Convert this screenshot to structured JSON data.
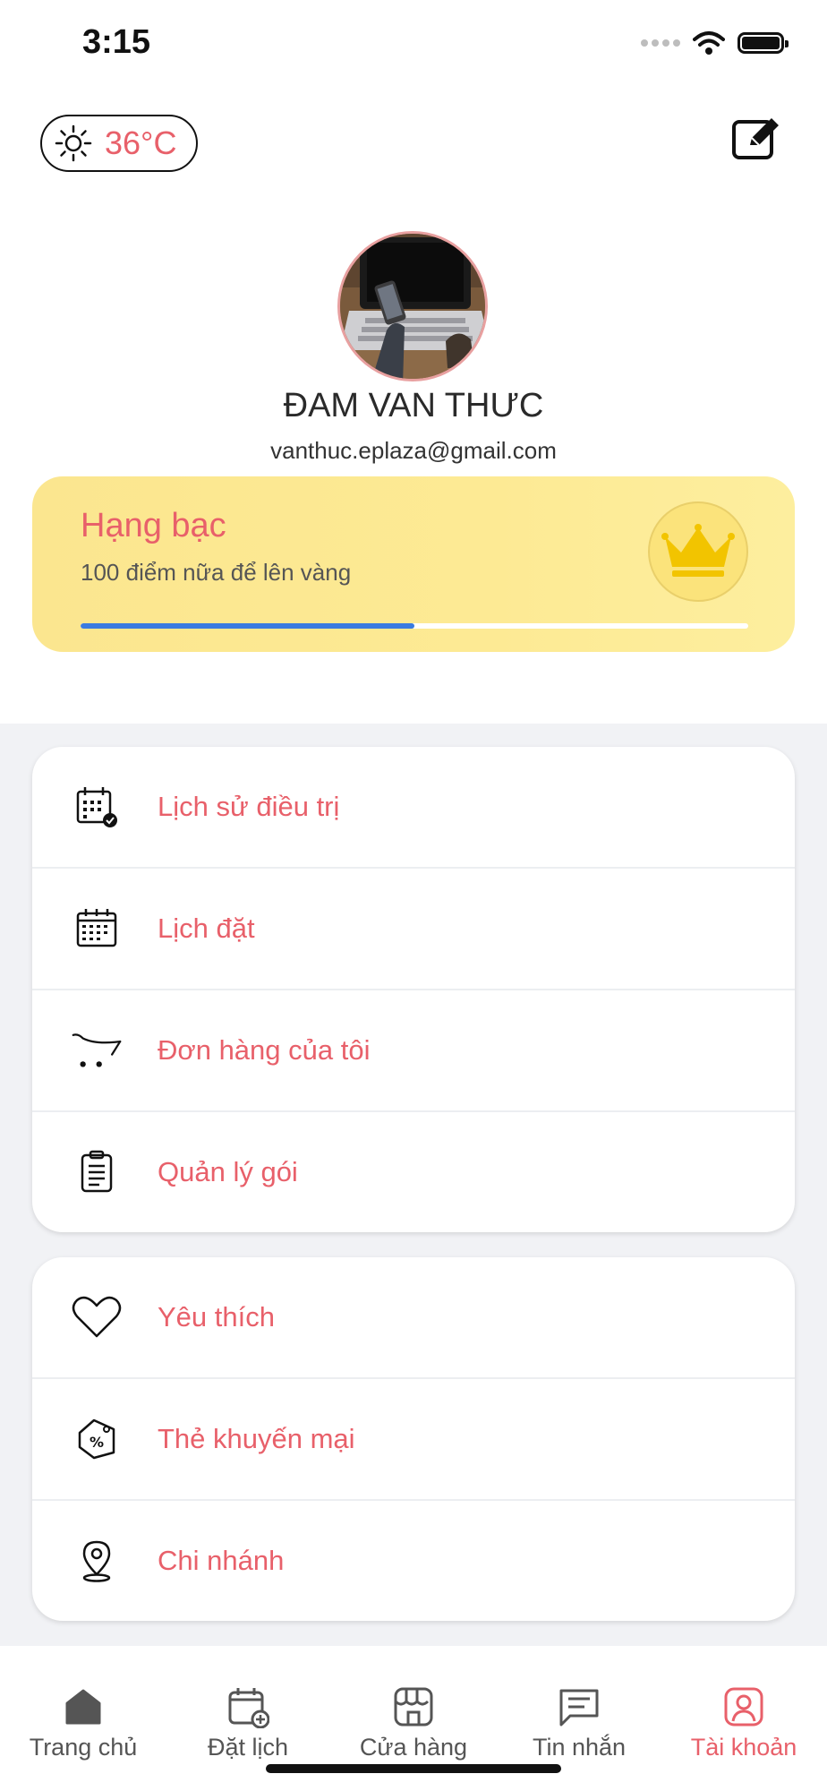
{
  "status_bar": {
    "time": "3:15"
  },
  "header": {
    "weather": {
      "icon": "sun-icon",
      "temperature": "36°C"
    },
    "edit_icon": "edit-icon"
  },
  "profile": {
    "name": "ĐAM VAN THƯC",
    "email": "vanthuc.eplaza@gmail.com"
  },
  "rank": {
    "title": "Hạng bạc",
    "subtitle": "100 điểm nữa để lên vàng",
    "icon": "crown-icon",
    "progress": 0.5
  },
  "menu_group_1": [
    {
      "label": "Lịch sử điều trị",
      "icon": "calendar-check-icon"
    },
    {
      "label": "Lịch đặt",
      "icon": "calendar-icon"
    },
    {
      "label": "Đơn hàng của tôi",
      "icon": "cart-icon"
    },
    {
      "label": "Quản lý gói",
      "icon": "clipboard-icon"
    }
  ],
  "menu_group_2": [
    {
      "label": "Yêu thích",
      "icon": "heart-icon"
    },
    {
      "label": "Thẻ khuyến mại",
      "icon": "discount-tag-icon"
    },
    {
      "label": "Chi nhánh",
      "icon": "location-pin-icon"
    }
  ],
  "bottom_nav": [
    {
      "label": "Trang chủ",
      "icon": "home-icon",
      "active": false
    },
    {
      "label": "Đặt lịch",
      "icon": "calendar-add-icon",
      "active": false
    },
    {
      "label": "Cửa hàng",
      "icon": "store-icon",
      "active": false
    },
    {
      "label": "Tin nhắn",
      "icon": "message-icon",
      "active": false
    },
    {
      "label": "Tài khoản",
      "icon": "account-icon",
      "active": true
    }
  ],
  "colors": {
    "accent": "#e8606a",
    "progress": "#3a7be0",
    "rank_card": "#fde98f"
  }
}
